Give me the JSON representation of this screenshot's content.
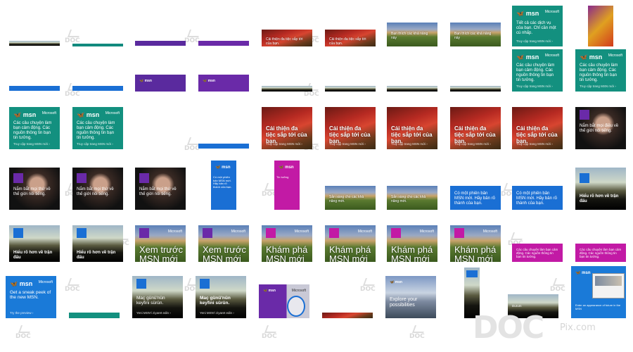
{
  "watermark": {
    "mark": "DOC",
    "site": "DOC",
    "pix": "Pix.com"
  },
  "msn": "msn",
  "microsoft": "Microsoft",
  "cta_vi": "Truy cập trang MSN mới ›",
  "cta_tr": "Yeni MSN'i ziyaret edin ›",
  "cta_en": "Try the preview ›",
  "teal_text": "Các câu chuyện làm bạn cảm động. Các nguồn thông tin bạn tin tưởng.",
  "teal_text_a": "Các câu chuyện làm bạn cảm động.",
  "teal_text_b": "Các nguồn thông tin bạn tin tưởng.",
  "teal_top": "Tiết cả các dịch vụ của bạn. Chỉ cần một cú nhấp.",
  "flower_text": "Cải thiện đa tiệc sắp tới của bạn.",
  "woman_text": "Nắm bắt mọi điều về thế giới nói tiếng.",
  "woman_text_short": "Nắm bắt mọi thứ về thế giới nói tiếng.",
  "crowd_text": "Hiểu rõ hơn về trận đấu",
  "field_text": "Sẵn sàng cho các khả năng mới.",
  "field_text_b": "Bạn thích các khả năng này",
  "preview_text": "Xem trước MSN mới",
  "explore_text": "Khám phá MSN mới",
  "blue_text": "Có một phiên bản MSN mới. Hãy bản rõ thành của bạn.",
  "magenta_text": "Các câu chuyện làm bạn cảm động. Các nguồn thông tin bạn tin tưởng.",
  "sneak_text": "Get a sneak peek of the new MSN.",
  "keyfini_text": "Maç günü'nün keyfini sürün.",
  "possibilities_text": "Explore your possibilities",
  "purple_small": "Tin tưởng",
  "eng_preview": "Enter an appearance of future in the MSN",
  "page_curl": "Durum"
}
